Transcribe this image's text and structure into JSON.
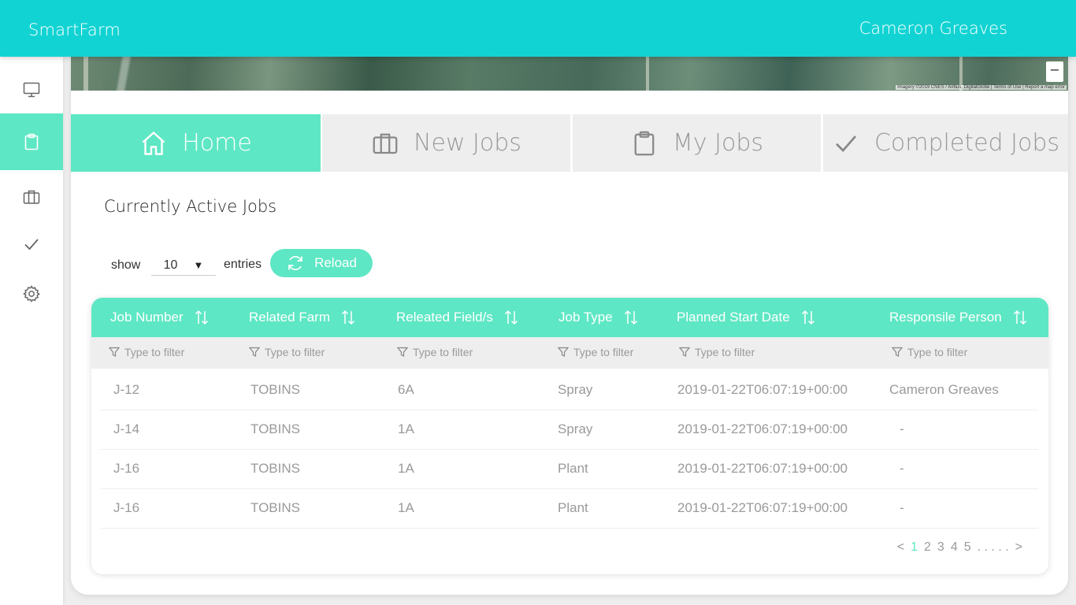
{
  "app": {
    "title": "SmartFarm",
    "user": "Cameron Greaves"
  },
  "colors": {
    "topbar": "#12d3d3",
    "accent": "#5ee7c4",
    "muted": "#9a9a9a"
  },
  "sidebar": {
    "items": [
      {
        "icon": "monitor-icon",
        "active": false
      },
      {
        "icon": "clipboard-icon",
        "active": true
      },
      {
        "icon": "briefcase-icon",
        "active": false
      },
      {
        "icon": "checkmark-icon",
        "active": false
      },
      {
        "icon": "gear-icon",
        "active": false
      }
    ]
  },
  "map": {
    "credit": "Imagery ©2019 CNES / Airbus, DigitalGlobe | Terms of Use | Report a map error",
    "zoom_out": "−",
    "zoom_in": "+"
  },
  "tabs": [
    {
      "label": "Home",
      "icon": "home-icon",
      "active": true
    },
    {
      "label": "New Jobs",
      "icon": "briefcase-icon",
      "active": false
    },
    {
      "label": "My Jobs",
      "icon": "clipboard-icon",
      "active": false
    },
    {
      "label": "Completed Jobs",
      "icon": "checkmark-icon",
      "active": false
    }
  ],
  "section": {
    "title": "Currently Active Jobs"
  },
  "controls": {
    "show_label": "show",
    "entries_value": "10",
    "entries_label": "entries",
    "reload_label": "Reload"
  },
  "table": {
    "columns": [
      "Job Number",
      "Related Farm",
      "Releated Field/s",
      "Job Type",
      "Planned Start Date",
      "Responsile Person"
    ],
    "filter_placeholder": "Type to filter",
    "rows": [
      [
        "J-12",
        "TOBINS",
        "6A",
        "Spray",
        "2019-01-22T06:07:19+00:00",
        "Cameron Greaves"
      ],
      [
        "J-14",
        "TOBINS",
        "1A",
        "Spray",
        "2019-01-22T06:07:19+00:00",
        "-"
      ],
      [
        "J-16",
        "TOBINS",
        "1A",
        "Plant",
        "2019-01-22T06:07:19+00:00",
        "-"
      ],
      [
        "J-16",
        "TOBINS",
        "1A",
        "Plant",
        "2019-01-22T06:07:19+00:00",
        "-"
      ]
    ]
  },
  "pagination": {
    "prev": "<",
    "pages": [
      "1",
      "2",
      "3",
      "4",
      "5"
    ],
    "ellipsis": ". . . . .",
    "next": ">",
    "current": "1"
  }
}
